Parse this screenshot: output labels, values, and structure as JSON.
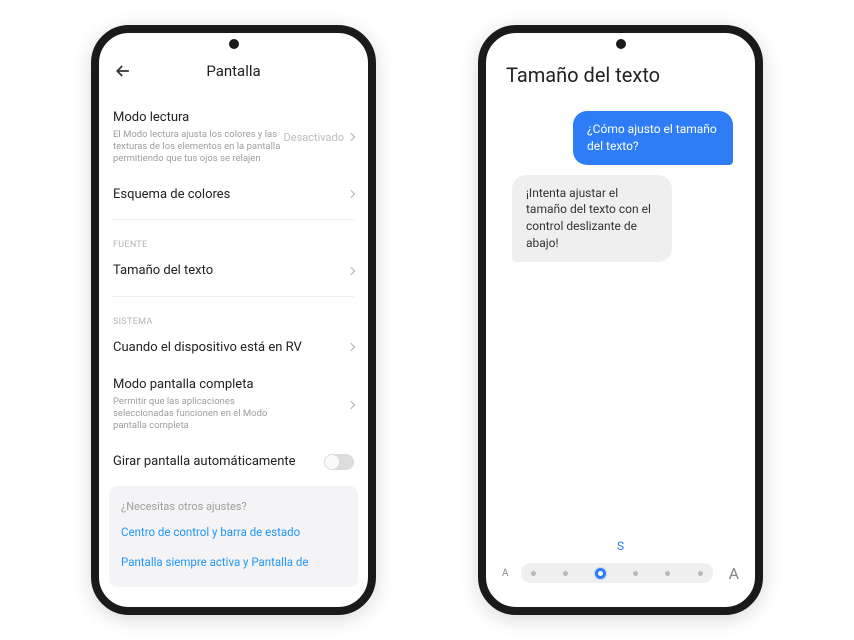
{
  "phone1": {
    "header_title": "Pantalla",
    "modo_lectura": {
      "title": "Modo lectura",
      "desc": "El Modo lectura ajusta los colores y las texturas de los elementos en la pantalla permitiendo que tus ojos se relajen",
      "value": "Desactivado"
    },
    "esquema_colores": {
      "title": "Esquema de colores"
    },
    "section_fuente": "FUENTE",
    "tamano_texto": {
      "title": "Tamaño del texto"
    },
    "section_sistema": "SISTEMA",
    "rv": {
      "title": "Cuando el dispositivo está en RV"
    },
    "pantalla_completa": {
      "title": "Modo pantalla completa",
      "desc": "Permitir que las aplicaciones seleccionadas funcionen en el Modo pantalla completa"
    },
    "girar": {
      "title": "Girar pantalla automáticamente"
    },
    "footer": {
      "label": "¿Necesitas otros ajustes?",
      "link1": "Centro de control y barra de estado",
      "link2": "Pantalla siempre activa y Pantalla de"
    }
  },
  "phone2": {
    "title": "Tamaño del texto",
    "bubble_blue": "¿Cómo ajusto el tamaño del texto?",
    "bubble_grey": "¡Intenta ajustar el tamaño del texto con el control deslizante de abajo!",
    "slider_label": "S",
    "slider_small_a": "A",
    "slider_big_a": "A",
    "slider_steps": 6,
    "slider_active_index": 2
  }
}
